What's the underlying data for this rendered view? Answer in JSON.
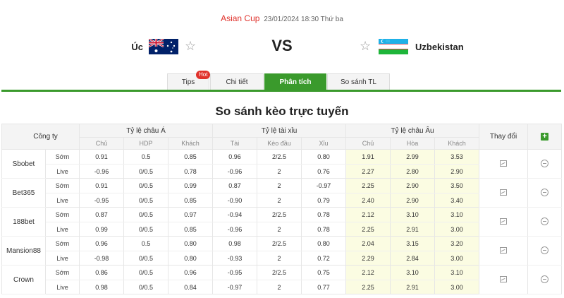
{
  "match": {
    "league": "Asian Cup",
    "datetime": "23/01/2024 18:30 Thứ ba",
    "home": "Úc",
    "away": "Uzbekistan",
    "vs": "VS"
  },
  "tabs": [
    {
      "label": "Tips",
      "badge": "Hot"
    },
    {
      "label": "Chi tiết"
    },
    {
      "label": "Phân tích",
      "active": true
    },
    {
      "label": "So sánh TL"
    }
  ],
  "title": "So sánh kèo trực tuyến",
  "table": {
    "company_header": "Công ty",
    "change_header": "Thay đổi",
    "groups": [
      "Tỷ lệ châu Á",
      "Tỷ lệ tài xỉu",
      "Tỷ lệ châu Âu"
    ],
    "sub_headers": [
      "Chủ",
      "HDP",
      "Khách",
      "Tài",
      "Kèo đầu",
      "Xỉu",
      "Chủ",
      "Hòa",
      "Khách"
    ],
    "rows": [
      {
        "company": "Sbobet",
        "early": {
          "label": "Sớm",
          "v": [
            "0.91",
            "0.5",
            "0.85",
            "0.96",
            "2/2.5",
            "0.80",
            "1.91",
            "2.99",
            "3.53"
          ]
        },
        "live": {
          "label": "Live",
          "v": [
            "-0.96",
            "0/0.5",
            "0.78",
            "-0.96",
            "2",
            "0.76",
            "2.27",
            "2.80",
            "2.90"
          ]
        }
      },
      {
        "company": "Bet365",
        "early": {
          "label": "Sớm",
          "v": [
            "0.91",
            "0/0.5",
            "0.99",
            "0.87",
            "2",
            "-0.97",
            "2.25",
            "2.90",
            "3.50"
          ]
        },
        "live": {
          "label": "Live",
          "v": [
            "-0.95",
            "0/0.5",
            "0.85",
            "-0.90",
            "2",
            "0.79",
            "2.40",
            "2.90",
            "3.40"
          ]
        }
      },
      {
        "company": "188bet",
        "early": {
          "label": "Sớm",
          "v": [
            "0.87",
            "0/0.5",
            "0.97",
            "-0.94",
            "2/2.5",
            "0.78",
            "2.12",
            "3.10",
            "3.10"
          ]
        },
        "live": {
          "label": "Live",
          "v": [
            "0.99",
            "0/0.5",
            "0.85",
            "-0.96",
            "2",
            "0.78",
            "2.25",
            "2.91",
            "3.00"
          ]
        }
      },
      {
        "company": "Mansion88",
        "early": {
          "label": "Sớm",
          "v": [
            "0.96",
            "0.5",
            "0.80",
            "0.98",
            "2/2.5",
            "0.80",
            "2.04",
            "3.15",
            "3.20"
          ]
        },
        "live": {
          "label": "Live",
          "v": [
            "-0.98",
            "0/0.5",
            "0.80",
            "-0.93",
            "2",
            "0.72",
            "2.29",
            "2.84",
            "3.00"
          ]
        }
      },
      {
        "company": "Crown",
        "early": {
          "label": "Sớm",
          "v": [
            "0.86",
            "0/0.5",
            "0.96",
            "-0.95",
            "2/2.5",
            "0.75",
            "2.12",
            "3.10",
            "3.10"
          ]
        },
        "live": {
          "label": "Live",
          "v": [
            "0.98",
            "0/0.5",
            "0.84",
            "-0.97",
            "2",
            "0.77",
            "2.25",
            "2.91",
            "3.00"
          ]
        }
      }
    ]
  },
  "colors": {
    "accent": "#3a9a2c",
    "league": "#e0312b",
    "eu_bg": "#fbfce2"
  }
}
